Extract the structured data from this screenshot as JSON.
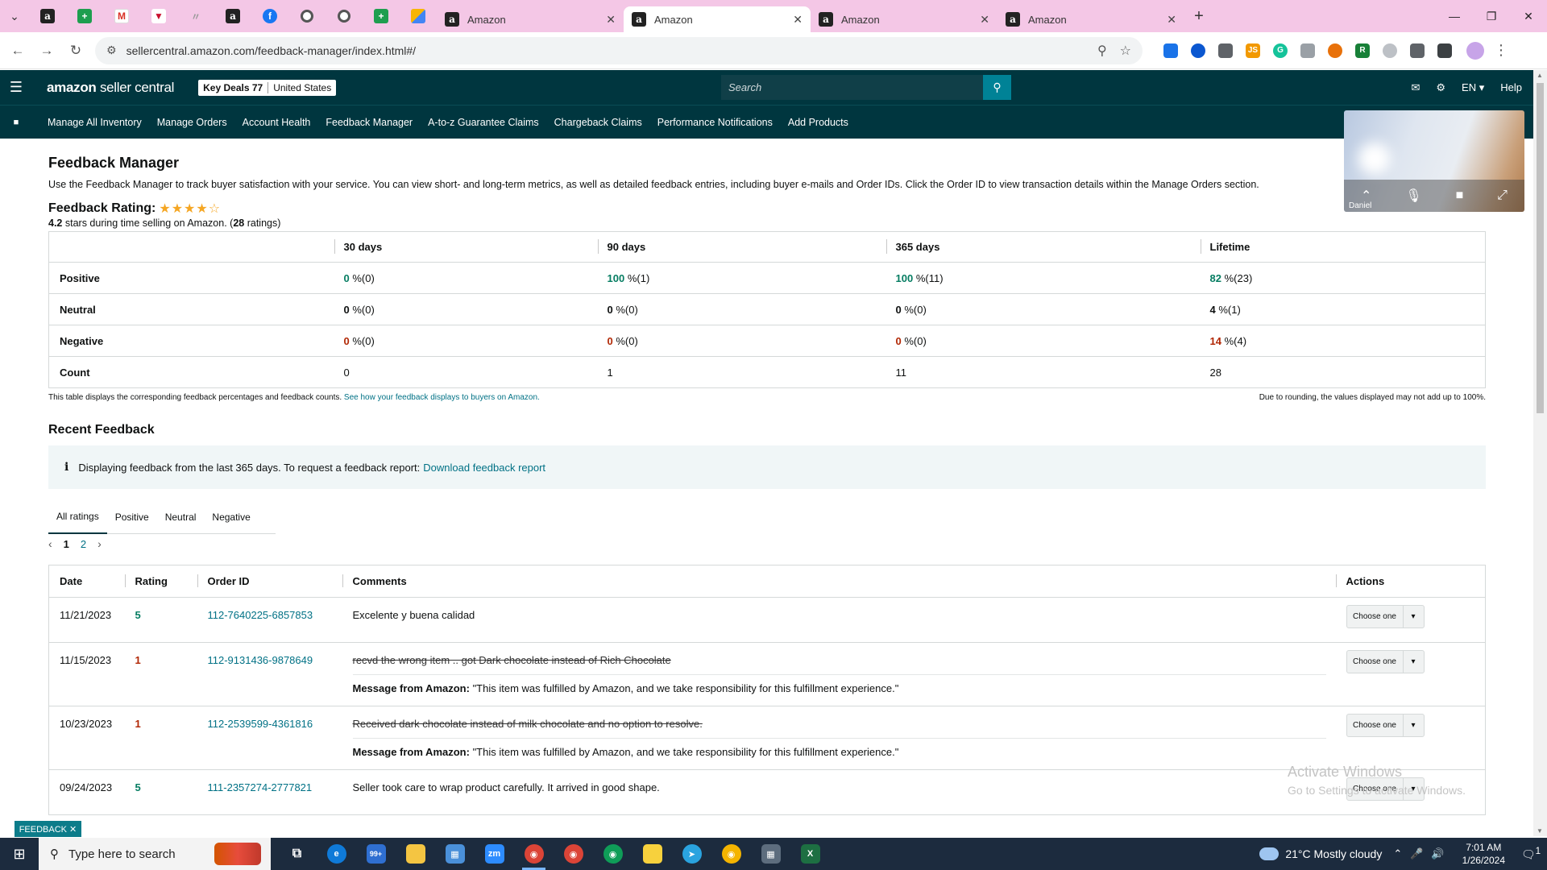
{
  "browser": {
    "tabs": [
      {
        "title": "Amazon",
        "active": false
      },
      {
        "title": "Amazon",
        "active": true
      },
      {
        "title": "Amazon",
        "active": false
      },
      {
        "title": "Amazon",
        "active": false
      }
    ],
    "url": "sellercentral.amazon.com/feedback-manager/index.html#/"
  },
  "header": {
    "logo_prefix": "amazon",
    "logo_suffix": "seller central",
    "store_name": "Key Deals 77",
    "marketplace": "United States",
    "search_placeholder": "Search",
    "language": "EN ▾",
    "help": "Help"
  },
  "nav": {
    "items": [
      "Manage All Inventory",
      "Manage Orders",
      "Account Health",
      "Feedback Manager",
      "A-to-z Guarantee Claims",
      "Chargeback Claims",
      "Performance Notifications",
      "Add Products"
    ]
  },
  "video": {
    "participant": "Daniel"
  },
  "page": {
    "title": "Feedback Manager",
    "intro": "Use the Feedback Manager to track buyer satisfaction with your service. You can view short- and long-term metrics, as well as detailed feedback entries, including buyer e-mails and Order IDs. Click the Order ID to view transaction details within the Manage Orders section.",
    "rating_title": "Feedback Rating:",
    "rating_value": "4.2",
    "rating_stars": "★★★★☆",
    "rating_text_a": "stars during time selling on Amazon. (",
    "rating_count": "28",
    "rating_text_b": "ratings)"
  },
  "metrics": {
    "columns": [
      "30 days",
      "90 days",
      "365 days",
      "Lifetime"
    ],
    "rows": [
      {
        "label": "Positive",
        "cells": [
          {
            "pct": "0",
            "rest": "%(0)"
          },
          {
            "pct": "100",
            "rest": "%(1)"
          },
          {
            "pct": "100",
            "rest": "%(11)"
          },
          {
            "pct": "82",
            "rest": "%(23)"
          }
        ]
      },
      {
        "label": "Neutral",
        "cells": [
          {
            "pct": "0",
            "rest": "%(0)"
          },
          {
            "pct": "0",
            "rest": "%(0)"
          },
          {
            "pct": "0",
            "rest": "%(0)"
          },
          {
            "pct": "4",
            "rest": "%(1)"
          }
        ]
      },
      {
        "label": "Negative",
        "cells": [
          {
            "pct": "0",
            "rest": "%(0)"
          },
          {
            "pct": "0",
            "rest": "%(0)"
          },
          {
            "pct": "0",
            "rest": "%(0)"
          },
          {
            "pct": "14",
            "rest": "%(4)"
          }
        ]
      },
      {
        "label": "Count",
        "cells": [
          "0",
          "1",
          "11",
          "28"
        ]
      }
    ],
    "note_left": "This table displays the corresponding feedback percentages and feedback counts.",
    "note_link": "See how your feedback displays to buyers on Amazon.",
    "note_right": "Due to rounding, the values displayed may not add up to 100%."
  },
  "recent": {
    "title": "Recent Feedback",
    "info_text": "Displaying feedback from the last 365 days. To request a feedback report:",
    "info_link": "Download feedback report",
    "filters": [
      "All ratings",
      "Positive",
      "Neutral",
      "Negative"
    ],
    "pages": [
      "1",
      "2"
    ],
    "columns": [
      "Date",
      "Rating",
      "Order ID",
      "Comments",
      "Actions"
    ],
    "action_label": "Choose one",
    "amazon_msg_label": "Message from Amazon:",
    "amazon_msg_text": "\"This item was fulfilled by Amazon, and we take responsibility for this fulfillment experience.\"",
    "rows": [
      {
        "date": "11/21/2023",
        "rating": "5",
        "order_id": "112-7640225-6857853",
        "comment": "Excelente y buena calidad"
      },
      {
        "date": "11/15/2023",
        "rating": "1",
        "order_id": "112-9131436-9878649",
        "comment": "recvd the wrong item .. got Dark chocolate instead of Rich Chocolate"
      },
      {
        "date": "10/23/2023",
        "rating": "1",
        "order_id": "112-2539599-4361816",
        "comment": "Received dark chocolate instead of milk chocolate and no option to resolve."
      },
      {
        "date": "09/24/2023",
        "rating": "5",
        "order_id": "111-2357274-2777821",
        "comment": "Seller took care to wrap product carefully. It arrived in good shape."
      }
    ]
  },
  "watermark": {
    "line1": "Activate Windows",
    "line2": "Go to Settings to activate Windows."
  },
  "feedback_tab": "FEEDBACK ✕",
  "taskbar": {
    "search_placeholder": "Type here to search",
    "weather": "21°C  Mostly cloudy",
    "time": "7:01 AM",
    "date": "1/26/2024",
    "mail_badge": "99+",
    "notif_count": "1"
  },
  "colors": {
    "header_bg": "#00363f",
    "link": "#007185",
    "positive": "#067d62",
    "negative": "#b12704",
    "tabbar": "#f4c7e6"
  }
}
